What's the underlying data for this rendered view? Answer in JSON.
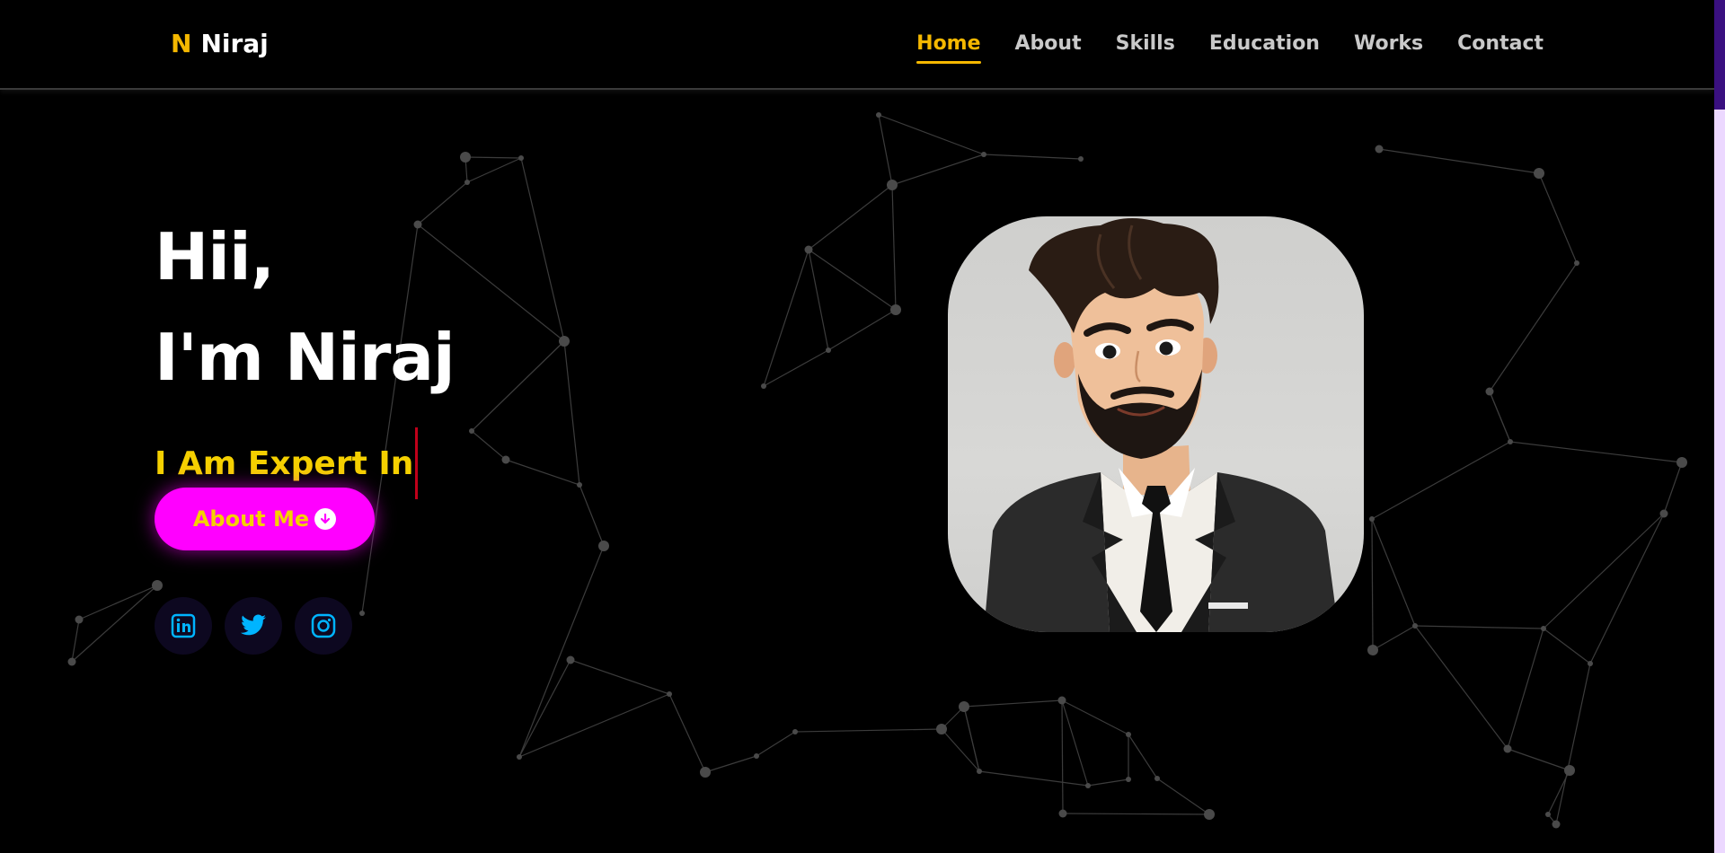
{
  "logo": {
    "letter": "N",
    "name": "Niraj"
  },
  "nav": {
    "items": [
      {
        "label": "Home",
        "active": true
      },
      {
        "label": "About",
        "active": false
      },
      {
        "label": "Skills",
        "active": false
      },
      {
        "label": "Education",
        "active": false
      },
      {
        "label": "Works",
        "active": false
      },
      {
        "label": "Contact",
        "active": false
      }
    ]
  },
  "hero": {
    "greeting": "Hii,",
    "name_line": "I'm Niraj",
    "expert_text": "I Am Expert In",
    "about_button": "About Me",
    "avatar_icon": "profile-avatar"
  },
  "socials": [
    {
      "icon": "linkedin-icon"
    },
    {
      "icon": "twitter-icon"
    },
    {
      "icon": "instagram-icon"
    }
  ],
  "colors": {
    "accent": "#f5b800",
    "subtitle": "#f5d000",
    "button": "#ff00ff",
    "social_icon": "#00b4ff",
    "background": "#000000"
  }
}
